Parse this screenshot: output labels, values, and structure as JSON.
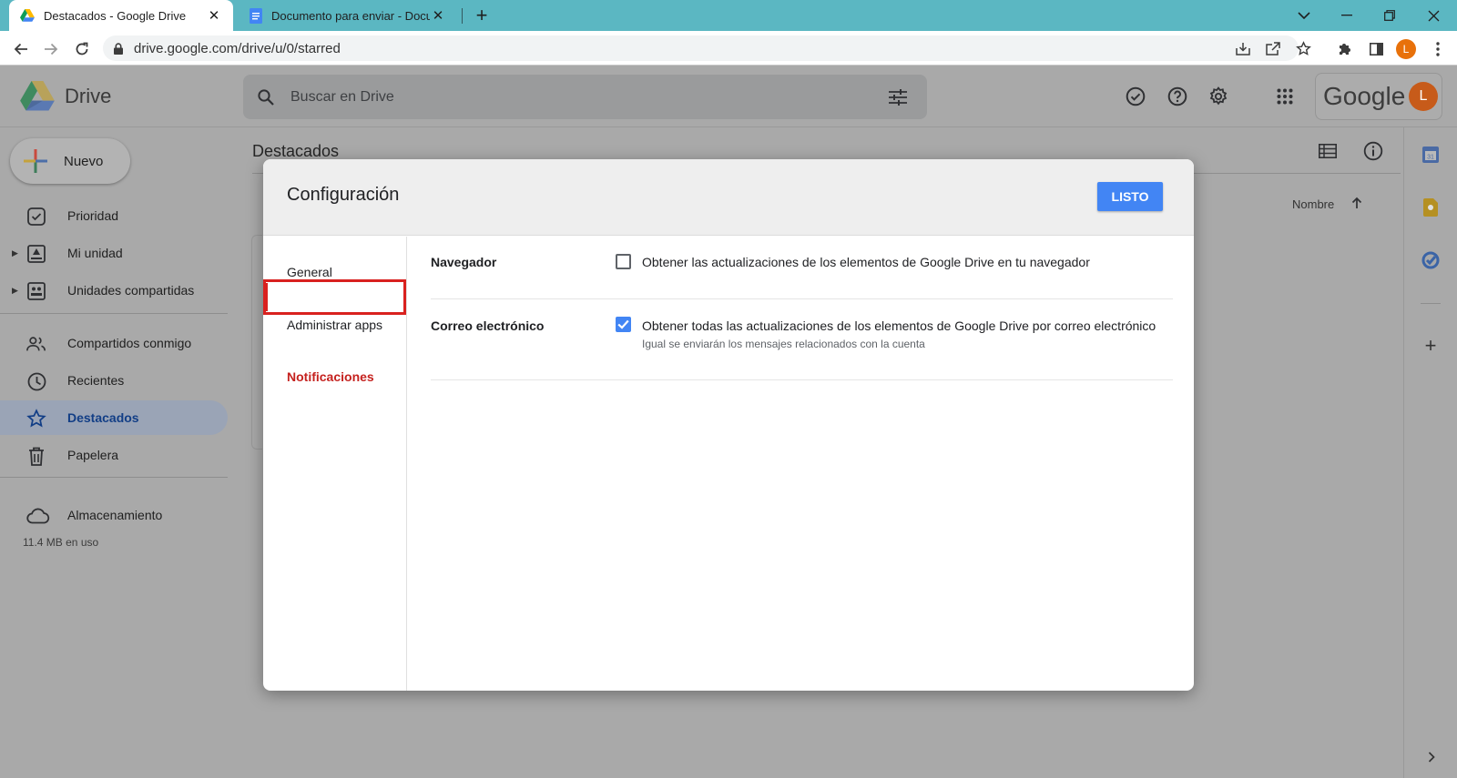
{
  "browser": {
    "tabs": [
      {
        "title": "Destacados - Google Drive",
        "active": true,
        "icon": "google-drive-icon"
      },
      {
        "title": "Documento para enviar - Docum",
        "active": false,
        "icon": "google-docs-icon"
      }
    ],
    "new_tab_icon": "plus-icon",
    "url": "drive.google.com/drive/u/0/starred",
    "profile_letter": "L"
  },
  "header": {
    "product": "Drive",
    "search_placeholder": "Buscar en Drive",
    "google_word": "Google",
    "avatar_letter": "L"
  },
  "sidebar": {
    "new_label": "Nuevo",
    "items": [
      {
        "label": "Prioridad",
        "icon": "priority-check-icon"
      },
      {
        "label": "Mi unidad",
        "icon": "my-drive-icon",
        "expandable": true
      },
      {
        "label": "Unidades compartidas",
        "icon": "shared-drives-icon",
        "expandable": true
      },
      {
        "label": "Compartidos conmigo",
        "icon": "people-icon"
      },
      {
        "label": "Recientes",
        "icon": "clock-icon"
      },
      {
        "label": "Destacados",
        "icon": "star-icon",
        "active": true
      },
      {
        "label": "Papelera",
        "icon": "trash-icon"
      }
    ],
    "storage_label": "Almacenamiento",
    "storage_used": "11.4 MB en uso"
  },
  "main": {
    "title": "Destacados",
    "sort_label": "Nombre"
  },
  "dialog": {
    "title": "Configuración",
    "done_label": "LISTO",
    "nav": [
      {
        "label": "General"
      },
      {
        "label": "Notificaciones",
        "active": true
      },
      {
        "label": "Administrar apps"
      }
    ],
    "sections": [
      {
        "label": "Navegador",
        "option": "Obtener las actualizaciones de los elementos de Google Drive en tu navegador",
        "checked": false
      },
      {
        "label": "Correo electrónico",
        "option": "Obtener todas las actualizaciones de los elementos de Google Drive por correo electrónico",
        "note": "Igual se enviarán los mensajes relacionados con la cuenta",
        "checked": true
      }
    ]
  },
  "colors": {
    "accent_blue": "#4285f4",
    "highlight_red": "#d9211f",
    "tab_strip": "#5bb7c2"
  }
}
